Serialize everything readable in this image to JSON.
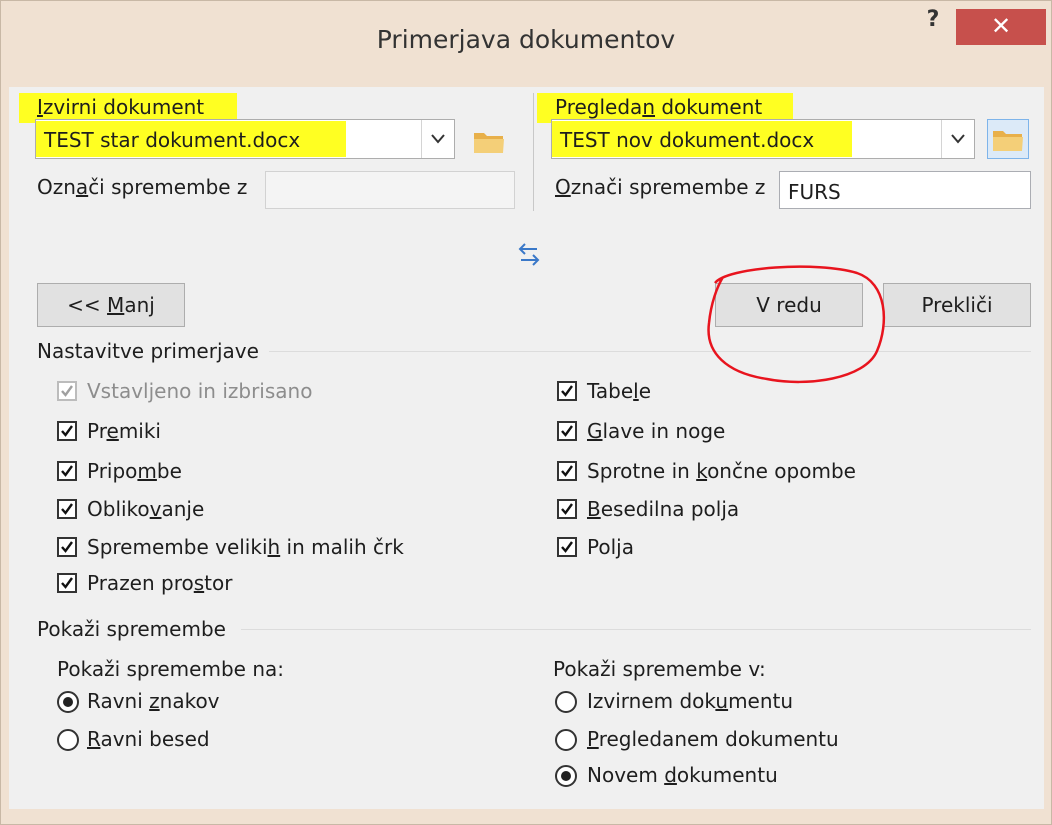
{
  "window": {
    "title": "Primerjava dokumentov",
    "help_glyph": "?",
    "close_glyph": "✕"
  },
  "original": {
    "label_pre": "",
    "label_mn": "I",
    "label_post": "zvirni dokument",
    "value": "TEST star dokument.docx",
    "mark_pre": "Ozn",
    "mark_mn": "a",
    "mark_post": "či spremembe z",
    "mark_value": ""
  },
  "revised": {
    "label_pre": "Pregleda",
    "label_mn": "n",
    "label_post": " dokument",
    "value": "TEST nov dokument.docx",
    "mark_pre": "",
    "mark_mn": "O",
    "mark_post": "znači spremembe z",
    "mark_value": "FURS"
  },
  "buttons": {
    "less_pre": "<< ",
    "less_mn": "M",
    "less_post": "anj",
    "ok": "V redu",
    "cancel": "Prekliči"
  },
  "settings": {
    "heading": "Nastavitve primerjave",
    "left": [
      {
        "pre": "Vstavljeno in izbrisano",
        "mn": "",
        "post": "",
        "checked": true,
        "disabled": true
      },
      {
        "pre": "Pr",
        "mn": "e",
        "post": "miki",
        "checked": true,
        "disabled": false
      },
      {
        "pre": "Pripo",
        "mn": "m",
        "post": "be",
        "checked": true,
        "disabled": false
      },
      {
        "pre": "Obliko",
        "mn": "v",
        "post": "anje",
        "checked": true,
        "disabled": false
      },
      {
        "pre": "Spremembe veliki",
        "mn": "h",
        "post": " in malih črk",
        "checked": true,
        "disabled": false
      },
      {
        "pre": "Prazen pro",
        "mn": "s",
        "post": "tor",
        "checked": true,
        "disabled": false
      }
    ],
    "right": [
      {
        "pre": "Tabe",
        "mn": "l",
        "post": "e",
        "checked": true
      },
      {
        "pre": "",
        "mn": "G",
        "post": "lave in noge",
        "checked": true
      },
      {
        "pre": "Sprotne in ",
        "mn": "k",
        "post": "ončne opombe",
        "checked": true
      },
      {
        "pre": "",
        "mn": "B",
        "post": "esedilna polja",
        "checked": true
      },
      {
        "pre": "Pol",
        "mn": "j",
        "post": "a",
        "checked": true
      }
    ]
  },
  "show": {
    "heading": "Pokaži spremembe",
    "on_label": "Pokaži spremembe na:",
    "on_options": [
      {
        "pre": "Ravni ",
        "mn": "z",
        "post": "nakov",
        "selected": true
      },
      {
        "pre": "",
        "mn": "R",
        "post": "avni besed",
        "selected": false
      }
    ],
    "in_label": "Pokaži spremembe v:",
    "in_options": [
      {
        "pre": "Izvirnem dok",
        "mn": "u",
        "post": "mentu",
        "selected": false
      },
      {
        "pre": "",
        "mn": "P",
        "post": "regledanem dokumentu",
        "selected": false
      },
      {
        "pre": "Novem ",
        "mn": "d",
        "post": "okumentu",
        "selected": true
      }
    ]
  },
  "colors": {
    "highlight": "#ffff22",
    "annotation_circle": "#e8141e",
    "close_button": "#c7504c"
  },
  "icons": {
    "swap": "swap-arrows-icon",
    "folder": "folder-icon"
  }
}
